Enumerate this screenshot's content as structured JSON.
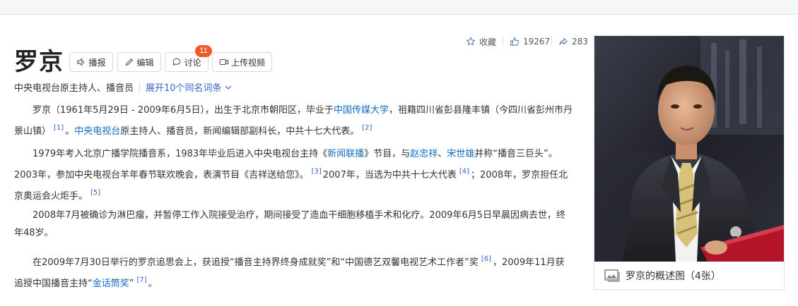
{
  "header": {
    "title": "罗京",
    "buttons": {
      "broadcast": "播报",
      "edit": "编辑",
      "discuss": "讨论",
      "discuss_badge": "11",
      "upload_video": "上传视频"
    },
    "subtitle": "中央电视台原主持人、播音员",
    "expand_link": "展开10个同名词条"
  },
  "stats": {
    "favorite_label": "收藏",
    "likes": "19267",
    "shares": "283"
  },
  "paragraphs": {
    "p1": {
      "t1": "罗京（1961年5月29日 - 2009年6月5日），出生于北京市朝阳区，毕业于",
      "l1": "中国传媒大学",
      "t2": "，祖籍四川省彭县隆丰镇（今四川省彭州市丹景山镇）",
      "r1": "[1]",
      "t3": "。",
      "l2": "中央电视台",
      "t4": "原主持人、播音员，新闻编辑部副科长，中共十七大代表。",
      "r2": "[2]"
    },
    "p2": {
      "t1": "1979年考入北京广播学院播音系，1983年毕业后进入中央电视台主持《",
      "l1": "新闻联播",
      "t2": "》节目，与",
      "l2": "赵忠祥",
      "t3": "、",
      "l3": "宋世雄",
      "t4": "并称“播音三巨头”。2003年，参加中央电视台羊年春节联欢晚会，表演节目《吉祥送给您》。",
      "r1": "[3]",
      "t5": "2007年，当选为中共十七大代表",
      "r2": "[4]",
      "t6": "；2008年，罗京担任北京奥运会火炬手。",
      "r3": "[5]"
    },
    "p3": {
      "t1": "2008年7月被确诊为淋巴瘤，并暂停工作入院接受治疗，期间接受了造血干细胞移植手术和化疗。2009年6月5日早晨因病去世，终年48岁。"
    },
    "p4": {
      "t1": "在2009年7月30日举行的罗京追思会上，获追授“播音主持界终身成就奖”和“中国德艺双馨电视艺术工作者”奖",
      "r1": "[6]",
      "t2": "，2009年11月获追授中国播音主持“",
      "l1": "金话筒奖",
      "t3": "”",
      "r2": "[7]",
      "t4": "。"
    }
  },
  "album": {
    "caption": "罗京的概述图（4张）"
  },
  "colors": {
    "link": "#136ec2",
    "badge": "#f05a28",
    "expand": "#3366cc"
  }
}
